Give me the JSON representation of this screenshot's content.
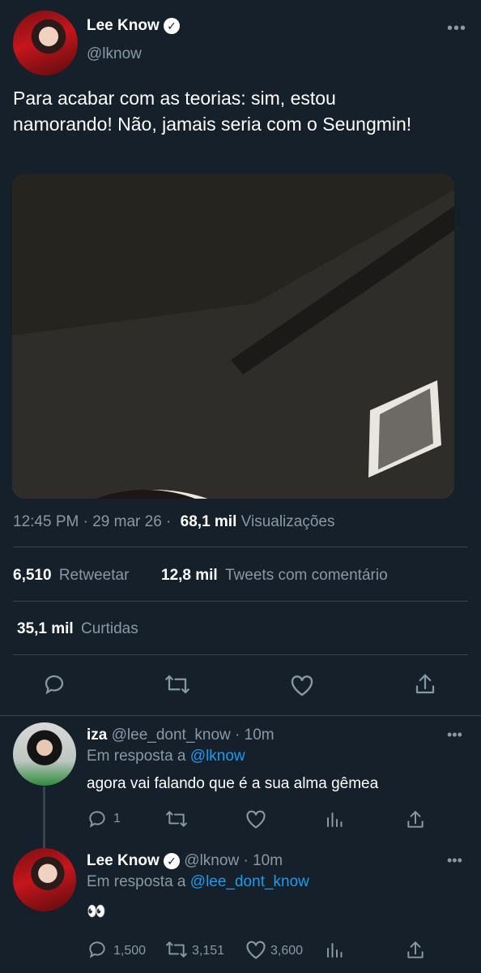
{
  "tweet": {
    "name": "Lee Know",
    "handle": "@lknow",
    "more_icon": "more-horizontal-icon",
    "text": "Para acabar com as teorias: sim, estou namorando! Não, jamais seria com o Seungmin!",
    "time": "12:45 PM",
    "date": "29 mar 26",
    "views_count": "68,1 mil",
    "views_label": "Visualizações",
    "retweets_count": "6,510",
    "retweets_label": "Retweetar",
    "quotes_count": "12,8 mil",
    "quotes_label": "Tweets com comentário",
    "likes_count": "35,1 mil",
    "likes_label": "Curtidas"
  },
  "actions": [
    "reply-icon",
    "retweet-icon",
    "like-icon",
    "share-icon"
  ],
  "replies": [
    {
      "name": "iza",
      "handle": "@lee_dont_know",
      "time": "10m",
      "reply_to_label": "Em resposta a",
      "reply_to_handle": "@lknow",
      "text": "agora vai falando que é a sua alma gêmea",
      "reply_count": "1",
      "retweet_count": "",
      "like_count": ""
    },
    {
      "name": "Lee Know",
      "handle": "@lknow",
      "time": "10m",
      "reply_to_label": "Em resposta a",
      "reply_to_handle": "@lee_dont_know",
      "text": "👀",
      "reply_count": "1,500",
      "retweet_count": "3,151",
      "like_count": "3,600"
    }
  ],
  "colors": {
    "background": "#15202b",
    "secondary_text": "#8899a6",
    "link": "#1d9bf0",
    "divider": "#38444d"
  }
}
